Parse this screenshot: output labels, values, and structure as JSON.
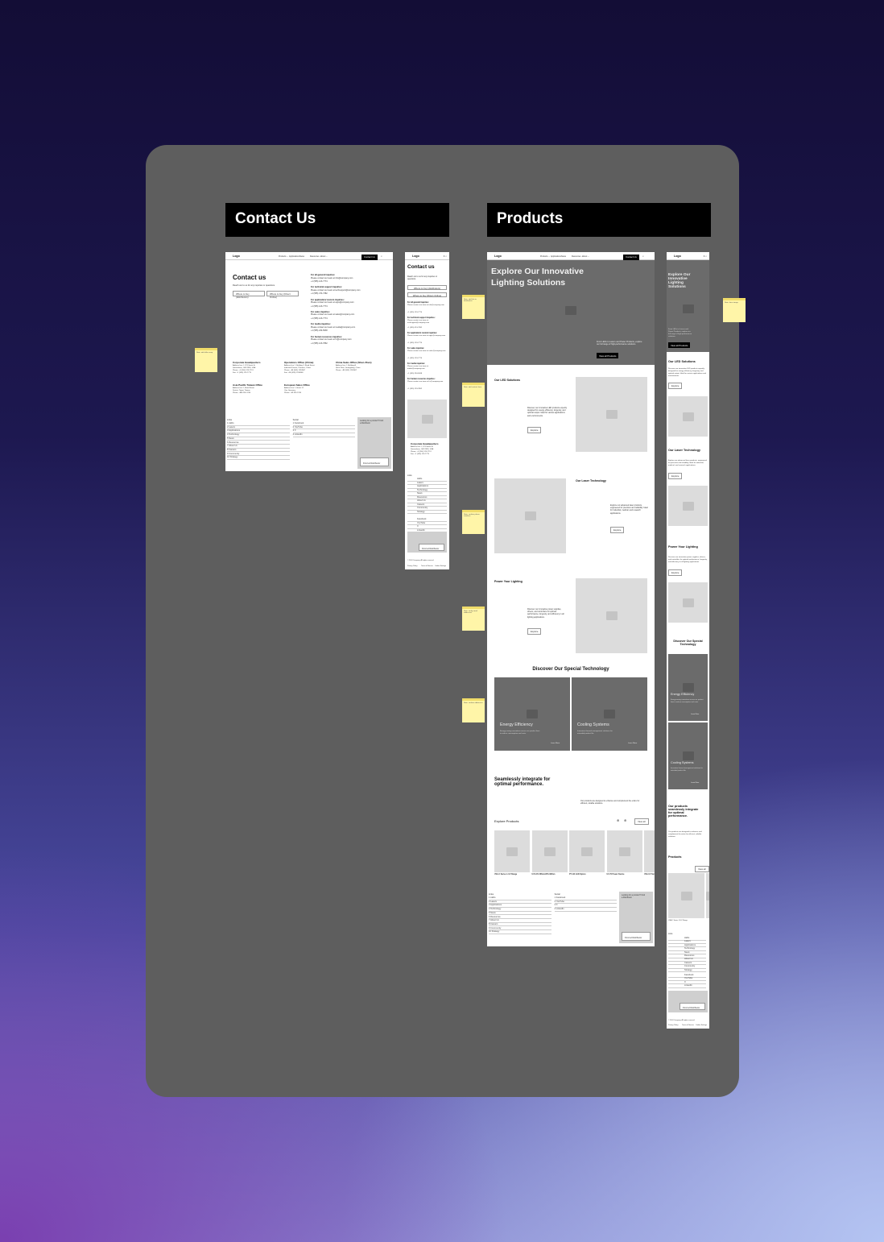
{
  "board": {
    "background": "#5e5e5e",
    "sections": [
      "Contact Us",
      "Products"
    ]
  },
  "nav": {
    "logo": "Logo",
    "items": [
      "Products ⌄",
      "Applications",
      "News",
      "Resources ⌄",
      "About ⌄"
    ],
    "cta": "Contact Us"
  },
  "contact": {
    "title": "Contact us",
    "subtitle": "Reach out to us for any inquiries or questions.",
    "buttons": [
      "Where to buy (distributors)",
      "Where to buy (Direct Online)"
    ],
    "inquiries": [
      {
        "label": "For all general inquiries:",
        "text": "Please contact our team at info@company.com",
        "phone": "+1 (555) 123-7774"
      },
      {
        "label": "For technical support inquiries:",
        "text": "Please contact our team at techsupport@company.com",
        "phone": "+1 (555) 474-7382"
      },
      {
        "label": "For application/ custom inquiries:",
        "text": "Please contact our team at apps@company.com",
        "phone": "+1 (555) 123-7774"
      },
      {
        "label": "For sales inquiries:",
        "text": "Please contact our team at sales@company.com",
        "phone": "+1 (555) 123-7774"
      },
      {
        "label": "For media inquiries:",
        "text": "Please contact our team at media@company.com",
        "phone": "+1 (555) 234-5638"
      },
      {
        "label": "For human resources inquiries:",
        "text": "Please contact our team at hr@company.com",
        "phone": "+1 (555) 123-7862"
      }
    ],
    "offices": [
      {
        "name": "Corporate Headquarters",
        "lines": [
          "Address line 1, 123 Street St",
          "Somewhere, CA 12345, USA",
          "Phone: +1 (555) 123-7774",
          "Fax: +1 (555) 123-7775"
        ]
      },
      {
        "name": "Operations Office (China)",
        "lines": [
          "Address line 1, Building 3, Road Street",
          "Industrial District, Province, China",
          "Phone: +86 (555) 1234567",
          "Fax: +86 (555) 1234568"
        ]
      },
      {
        "name": "China Sales Office (Shen Zhen)",
        "lines": [
          "Address line 1, Building A",
          "Shen Zhen, Guangdong, China",
          "Phone: +86 (555) 1234567"
        ]
      },
      {
        "name": "Asia Pacific Taiwan Office",
        "lines": [
          "Address line 1, Road Street",
          "District, Taipei, Taiwan",
          "Phone: +886 555 1234"
        ]
      },
      {
        "name": "European Sales Office",
        "lines": [
          "Address line 1, Street 12",
          "City, Germany",
          "Phone: +49 555 1234"
        ]
      }
    ]
  },
  "footer": {
    "col1_title": "Links",
    "col1": [
      "LEDs",
      "Lasers",
      "Applications",
      "Technology",
      "News",
      "Resources",
      "About Us",
      "Careers",
      "Community",
      "Strategy"
    ],
    "col2_title": "Social",
    "col2": [
      "Facebook",
      "YouTube",
      "X",
      "LinkedIn"
    ],
    "promo_text": "Looking for a product? Find a Distributor",
    "promo_cta": "Find a Distributor",
    "copyright": "© 2024 Company. All rights reserved.",
    "links": [
      "Privacy Policy",
      "Terms of Service",
      "Cookie Settings"
    ]
  },
  "products": {
    "hero_title": "Explore Our Innovative Lighting Solutions",
    "hero_desc": "From LEDs to Lasers and Power Products, explore our full range of high-performance solutions.",
    "hero_cta": "View all Products",
    "features": [
      {
        "title": "Our LED Solutions",
        "text": "Discover our innovative LED products expertly designed for energy efficiency, longevity, and optimal output. Ideal for various applications and environments.",
        "cta": "Explore"
      },
      {
        "title": "Our Laser Technology",
        "text": "Explore our advanced laser products, engineered for precision and reliability. Ideal for industrial, medical, and research applications.",
        "cta": "Explore"
      },
      {
        "title": "Power Your Lighting",
        "text": "Discover our innovative power supplies, drivers, and controllers for optimal performance, longevity, and efficiency in all lighting applications.",
        "cta": "Explore"
      }
    ],
    "tech_title": "Discover Our Special Technology",
    "tech_cards": [
      {
        "title": "Energy Efficiency",
        "text": "Energy-saving innovations across our product lines to reduce consumption and costs.",
        "cta": "Learn More"
      },
      {
        "title": "Cooling Systems",
        "text": "Innovative thermal management solutions for extended product life.",
        "cta": "Learn More"
      }
    ],
    "integrate_title": "Seamlessly integrate for optimal performance.",
    "integrate_text": "Our products are designed to enhance and complement the entire for efficient, reliable solutions.",
    "explore_title": "Explore Products",
    "explore_cta": "View all",
    "items": [
      "UVA-C Series 1-UV Range",
      "UVC-FS 365nm/370-395nm",
      "PT-110 LED Option",
      "UV-70 Power Device",
      "UVA-UV Ser"
    ]
  },
  "mobile_products": {
    "led_title": "Our LED Solutions",
    "laser_title": "Our Laser Technology",
    "power_title": "Power Your Lighting",
    "tech_title": "Discover Our Special Technology",
    "integrate_title": "Our products seamlessly integrate for optimal performance.",
    "products_title": "Products"
  },
  "stickies": [
    "Note: add office map",
    "Note: add link to distributors",
    "Note: add contact form",
    "Note: confirm phone numbers",
    "Note: verify email addresses",
    "Note: confirm addresses",
    "Note: hero image"
  ]
}
